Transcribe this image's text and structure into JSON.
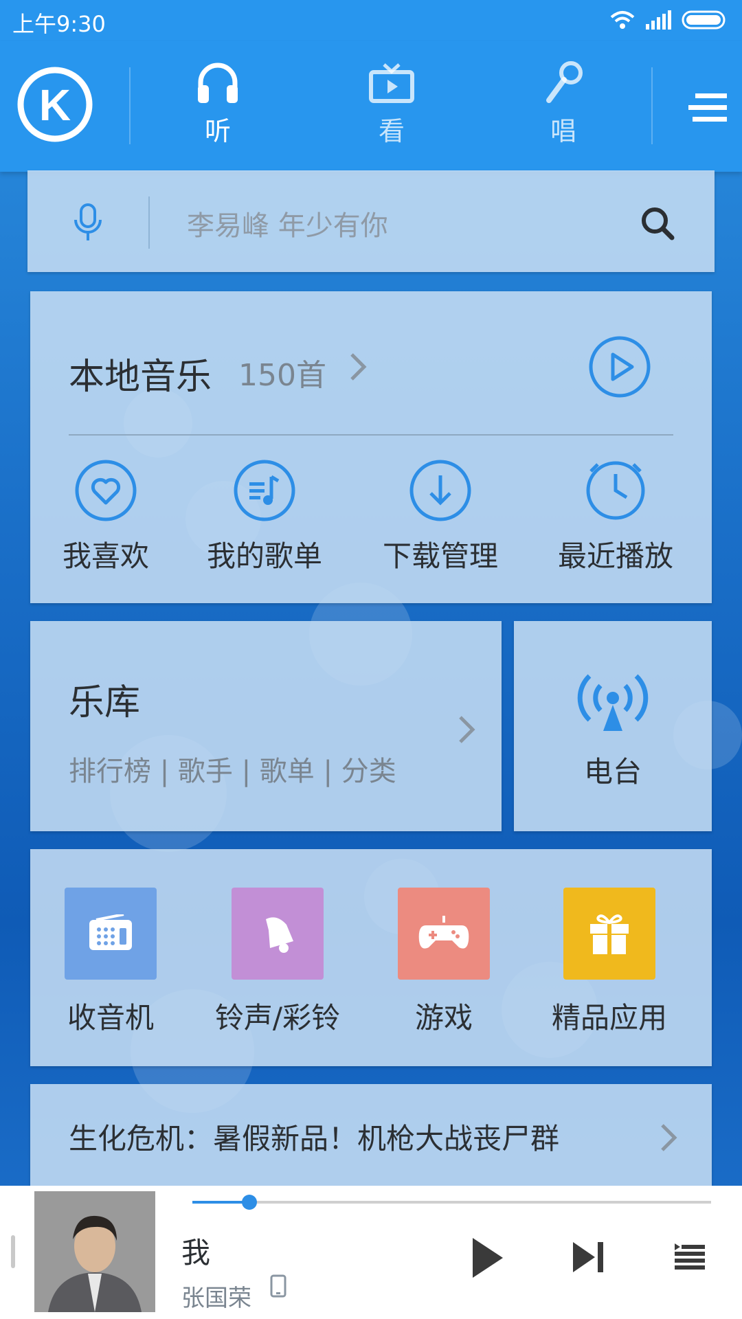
{
  "status_bar": {
    "time": "上午9:30",
    "icons": [
      "wifi-icon",
      "signal-icon",
      "battery-icon"
    ]
  },
  "top_nav": {
    "logo": "K",
    "tabs": [
      {
        "label": "听",
        "icon": "headphones-icon",
        "active": true
      },
      {
        "label": "看",
        "icon": "tv-icon",
        "active": false
      },
      {
        "label": "唱",
        "icon": "microphone-icon",
        "active": false
      }
    ],
    "menu_icon": "menu-icon"
  },
  "search": {
    "placeholder": "李易峰 年少有你",
    "voice_icon": "voice-search-icon",
    "search_icon": "search-icon"
  },
  "local_music": {
    "title": "本地音乐",
    "count": "150首",
    "quick": [
      {
        "label": "我喜欢",
        "icon": "heart-icon"
      },
      {
        "label": "我的歌单",
        "icon": "playlist-icon"
      },
      {
        "label": "下载管理",
        "icon": "download-icon"
      },
      {
        "label": "最近播放",
        "icon": "clock-icon"
      }
    ]
  },
  "library": {
    "title": "乐库",
    "subtitle": "排行榜 | 歌手 | 歌单 | 分类"
  },
  "radio": {
    "label": "电台"
  },
  "apps": [
    {
      "label": "收音机",
      "icon": "radio-icon",
      "color": "#6fa2e6"
    },
    {
      "label": "铃声/彩铃",
      "icon": "bell-icon",
      "color": "#c28fd6"
    },
    {
      "label": "游戏",
      "icon": "gamepad-icon",
      "color": "#ec8b80"
    },
    {
      "label": "精品应用",
      "icon": "gift-icon",
      "color": "#f0b91d"
    }
  ],
  "promo": {
    "text": "生化危机：暑假新品！机枪大战丧尸群"
  },
  "player": {
    "song": "我",
    "artist": "张国荣",
    "progress": 0.11
  },
  "colors": {
    "primary": "#2896ee",
    "accent": "#2d8ee6"
  }
}
